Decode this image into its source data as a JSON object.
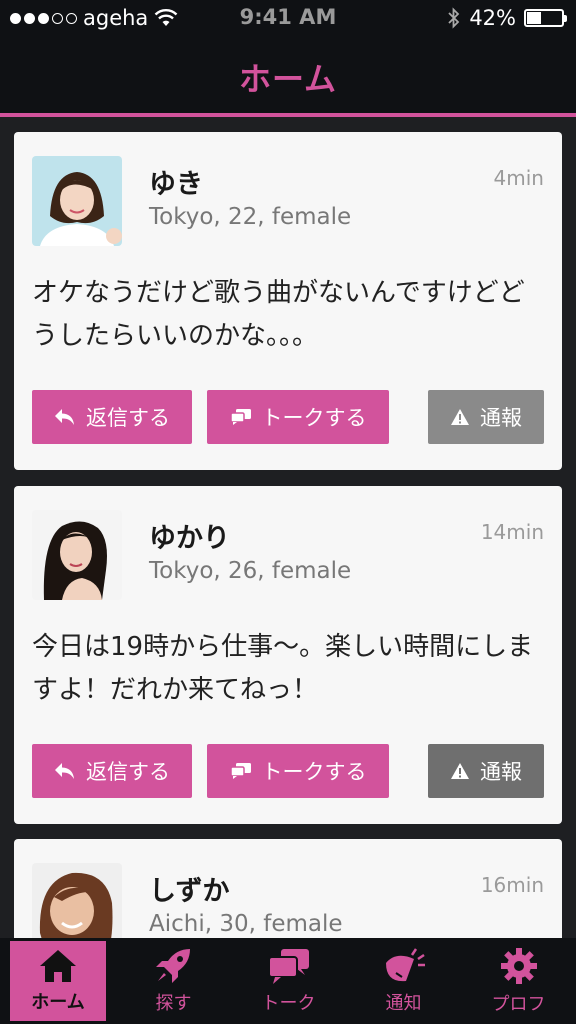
{
  "status_bar": {
    "carrier": "ageha",
    "time": "9:41 AM",
    "battery": "42%",
    "battery_level": 0.42,
    "signal_bars": 3
  },
  "header": {
    "title": "ホーム"
  },
  "posts": [
    {
      "name": "ゆき",
      "meta": "Tokyo, 22, female",
      "time": "4min",
      "message": "オケなうだけど歌う曲がないんですけどどうしたらいいのかな。。。",
      "reply_label": "返信する",
      "talk_label": "トークする",
      "report_label": "通報"
    },
    {
      "name": "ゆかり",
      "meta": "Tokyo, 26, female",
      "time": "14min",
      "message": "今日は19時から仕事〜。楽しい時間にしますよ！だれか来てねっ！",
      "reply_label": "返信する",
      "talk_label": "トークする",
      "report_label": "通報"
    },
    {
      "name": "しずか",
      "meta": "Aichi, 30, female",
      "time": "16min"
    }
  ],
  "tab_bar": {
    "items": [
      {
        "label": "ホーム",
        "icon": "home-icon",
        "active": true
      },
      {
        "label": "探す",
        "icon": "rocket-icon",
        "active": false
      },
      {
        "label": "トーク",
        "icon": "chat-icon",
        "active": false
      },
      {
        "label": "通知",
        "icon": "megaphone-icon",
        "active": false
      },
      {
        "label": "プロフ",
        "icon": "gear-icon",
        "active": false
      }
    ]
  },
  "colors": {
    "accent": "#d2539c",
    "header_bg": "#0f1114",
    "card_bg": "#f7f7f7",
    "report_bg": "#8a8a8a"
  }
}
